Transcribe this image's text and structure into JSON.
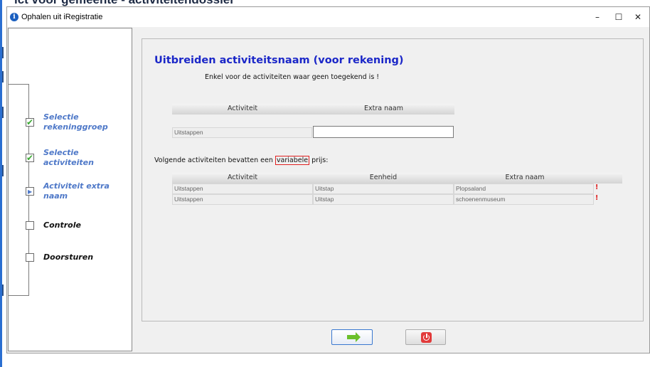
{
  "background_title": "ict voor gemeente - activiteitendossier",
  "window": {
    "title": "Ophalen uit iRegistratie",
    "minimize": "–",
    "maximize": "☐",
    "close": "✕"
  },
  "steps": [
    {
      "label_line1": "Selectie",
      "label_line2": "rekeninggroep",
      "state": "done"
    },
    {
      "label_line1": "Selectie",
      "label_line2": "activiteiten",
      "state": "done"
    },
    {
      "label_line1": "Activiteit extra",
      "label_line2": "naam",
      "state": "current"
    },
    {
      "label_line1": "Controle",
      "label_line2": "",
      "state": "pending"
    },
    {
      "label_line1": "Doorsturen",
      "label_line2": "",
      "state": "pending"
    }
  ],
  "panel": {
    "title": "Uitbreiden activiteitsnaam (voor rekening)",
    "subtitle": "Enkel voor de activiteiten waar geen toegekend is !",
    "table1": {
      "headers": [
        "Activiteit",
        "Extra naam"
      ],
      "rows": [
        {
          "activiteit": "Uitstappen",
          "extra_naam": ""
        }
      ]
    },
    "variable_text_before": "Volgende activiteiten bevatten een ",
    "variable_word": "variabele",
    "variable_text_after": " prijs:",
    "table2": {
      "headers": [
        "Activiteit",
        "Eenheid",
        "Extra naam"
      ],
      "rows": [
        {
          "activiteit": "Uitstappen",
          "eenheid": "Uitstap",
          "extra_naam": "Plopsaland",
          "flag": "!"
        },
        {
          "activiteit": "Uitstappen",
          "eenheid": "Uitstap",
          "extra_naam": "schoenenmuseum",
          "flag": "!"
        }
      ]
    }
  },
  "buttons": {
    "next": "next-arrow-icon",
    "stop": "power-icon"
  },
  "colors": {
    "title_blue": "#1b27c8",
    "step_active": "#4e78c8",
    "check_green": "#3aa832",
    "warning_red": "#e02020"
  }
}
